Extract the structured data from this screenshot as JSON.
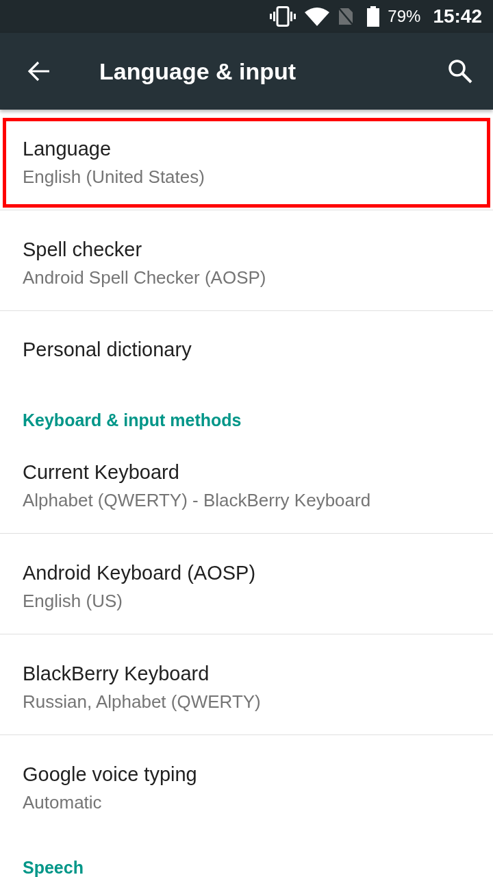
{
  "status_bar": {
    "battery_text": "79%",
    "time": "15:42"
  },
  "app_bar": {
    "title": "Language & input"
  },
  "list": [
    {
      "kind": "item",
      "title": "Language",
      "summary": "English (United States)",
      "highlighted": true
    },
    {
      "kind": "item",
      "title": "Spell checker",
      "summary": "Android Spell Checker (AOSP)",
      "highlighted": false
    },
    {
      "kind": "item",
      "title": "Personal dictionary",
      "highlighted": false
    },
    {
      "kind": "category",
      "title": "Keyboard & input methods"
    },
    {
      "kind": "item",
      "title": "Current Keyboard",
      "summary": "Alphabet (QWERTY) - BlackBerry Keyboard",
      "highlighted": false
    },
    {
      "kind": "item",
      "title": "Android Keyboard (AOSP)",
      "summary": "English (US)",
      "highlighted": false
    },
    {
      "kind": "item",
      "title": "BlackBerry Keyboard",
      "summary": "Russian, Alphabet (QWERTY)",
      "highlighted": false
    },
    {
      "kind": "item",
      "title": "Google voice typing",
      "summary": "Automatic",
      "highlighted": false
    },
    {
      "kind": "category",
      "title": "Speech"
    }
  ]
}
